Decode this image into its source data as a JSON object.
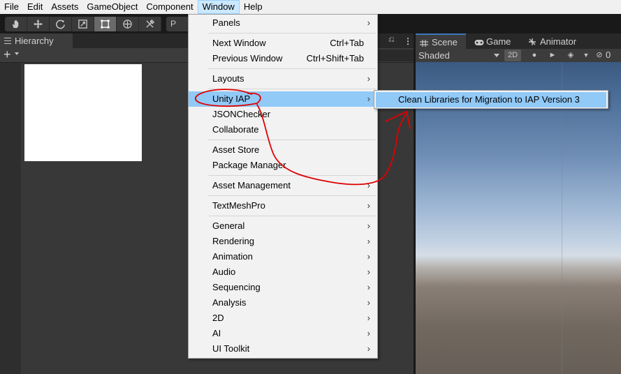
{
  "menubar": {
    "items": [
      "File",
      "Edit",
      "Assets",
      "GameObject",
      "Component",
      "Window",
      "Help"
    ],
    "active": "Window"
  },
  "toolbar": {
    "tools": [
      "hand-tool-icon",
      "move-tool-icon",
      "rotate-tool-icon",
      "scale-tool-icon",
      "rect-tool-icon",
      "transform-tool-icon",
      "custom-tool-icon"
    ],
    "selected_tool": "rect-tool-icon",
    "pivot_label": "P"
  },
  "hierarchy": {
    "tab_label": "Hierarchy",
    "add_button": "+"
  },
  "scene": {
    "tabs": [
      {
        "label": "Scene",
        "icon": "grid-icon",
        "active": true
      },
      {
        "label": "Game",
        "icon": "gamepad-icon",
        "active": false
      },
      {
        "label": "Animator",
        "icon": "animator-icon",
        "active": false
      }
    ],
    "shading_mode": "Shaded",
    "toggle_2d": "2D",
    "hidden_count": "0"
  },
  "window_menu": {
    "items": [
      {
        "label": "Panels",
        "shortcut": "",
        "submenu": true
      },
      {
        "label": "Next Window",
        "shortcut": "Ctrl+Tab",
        "submenu": false
      },
      {
        "label": "Previous Window",
        "shortcut": "Ctrl+Shift+Tab",
        "submenu": false
      },
      {
        "label": "Layouts",
        "shortcut": "",
        "submenu": true
      },
      {
        "label": "Unity IAP",
        "shortcut": "",
        "submenu": true,
        "highlighted": true
      },
      {
        "label": "JSONChecker",
        "shortcut": "",
        "submenu": false
      },
      {
        "label": "Collaborate",
        "shortcut": "",
        "submenu": false
      },
      {
        "label": "Asset Store",
        "shortcut": "",
        "submenu": false
      },
      {
        "label": "Package Manager",
        "shortcut": "",
        "submenu": false
      },
      {
        "label": "Asset Management",
        "shortcut": "",
        "submenu": true
      },
      {
        "label": "TextMeshPro",
        "shortcut": "",
        "submenu": true
      },
      {
        "label": "General",
        "shortcut": "",
        "submenu": true
      },
      {
        "label": "Rendering",
        "shortcut": "",
        "submenu": true
      },
      {
        "label": "Animation",
        "shortcut": "",
        "submenu": true
      },
      {
        "label": "Audio",
        "shortcut": "",
        "submenu": true
      },
      {
        "label": "Sequencing",
        "shortcut": "",
        "submenu": true
      },
      {
        "label": "Analysis",
        "shortcut": "",
        "submenu": true
      },
      {
        "label": "2D",
        "shortcut": "",
        "submenu": true
      },
      {
        "label": "AI",
        "shortcut": "",
        "submenu": true
      },
      {
        "label": "UI Toolkit",
        "shortcut": "",
        "submenu": true
      }
    ]
  },
  "iap_submenu": {
    "items": [
      "Clean Libraries for Migration to IAP Version 3"
    ]
  },
  "colors": {
    "menu_highlight": "#91c9f7",
    "annotation": "#e00000"
  }
}
